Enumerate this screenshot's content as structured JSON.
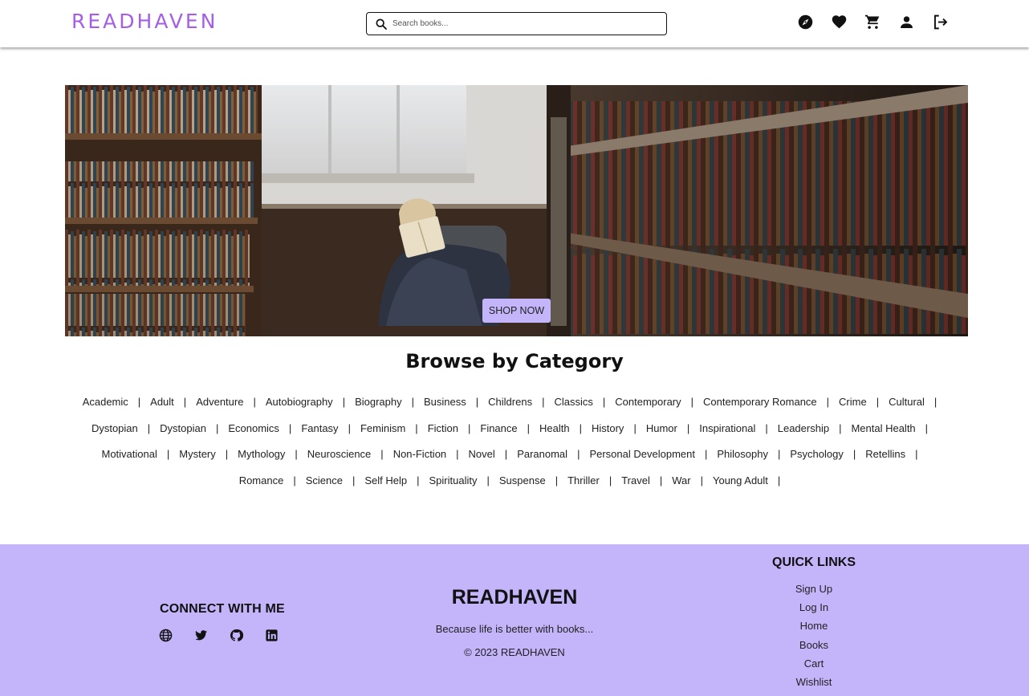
{
  "brand": "READHAVEN",
  "colors": {
    "accent": "#a55ee6",
    "lavender": "#c4b5fb"
  },
  "search": {
    "placeholder": "Search books..."
  },
  "nav": {
    "icons": [
      "compass-icon",
      "heart-icon",
      "cart-icon",
      "person-icon",
      "logout-icon"
    ]
  },
  "hero": {
    "button": "SHOP NOW"
  },
  "browse": {
    "title": "Browse by Category",
    "rows": [
      [
        "Academic",
        "Adult",
        "Adventure",
        "Autobiography",
        "Biography",
        "Business",
        "Childrens",
        "Classics",
        "Contemporary",
        "Contemporary Romance",
        "Crime",
        "Cultural"
      ],
      [
        "Dystopian",
        "Dystopian",
        "Economics",
        "Fantasy",
        "Feminism",
        "Fiction",
        "Finance",
        "Health",
        "History",
        "Humor",
        "Inspirational",
        "Leadership",
        "Mental Health"
      ],
      [
        "Motivational",
        "Mystery",
        "Mythology",
        "Neuroscience",
        "Non-Fiction",
        "Novel",
        "Paranomal",
        "Personal Development",
        "Philosophy",
        "Psychology",
        "Retellins"
      ],
      [
        "Romance",
        "Science",
        "Self Help",
        "Spirituality",
        "Suspense",
        "Thriller",
        "Travel",
        "War",
        "Young Adult"
      ]
    ],
    "separator": "|"
  },
  "footer": {
    "connect_title": "CONNECT WITH ME",
    "social_icons": [
      "globe-icon",
      "twitter-icon",
      "github-icon",
      "linkedin-icon"
    ],
    "brand": "READHAVEN",
    "tagline": "Because life is better with books...",
    "copyright": "© 2023 READHAVEN",
    "quick_links_title": "QUICK LINKS",
    "quick_links": [
      "Sign Up",
      "Log In",
      "Home",
      "Books",
      "Cart",
      "Wishlist"
    ]
  }
}
